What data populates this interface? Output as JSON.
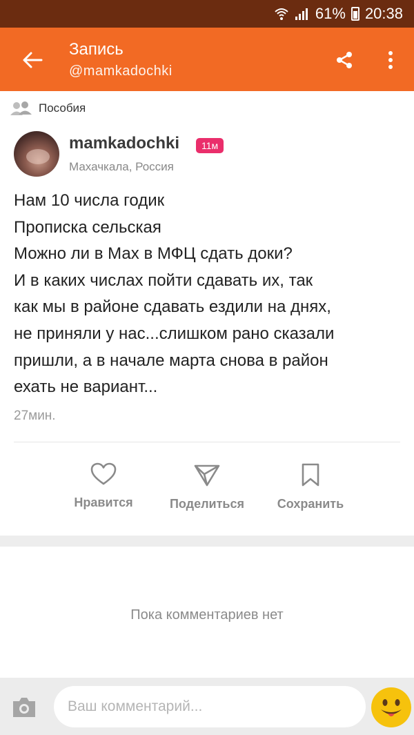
{
  "status_bar": {
    "battery": "61%",
    "time": "20:38"
  },
  "header": {
    "title": "Запись",
    "subtitle": "@mamkadochki",
    "accent_color": "#f26a24"
  },
  "group": {
    "label": "Пособия",
    "icon": "group-icon"
  },
  "author": {
    "name": "mamkadochki",
    "badge": "11м",
    "location": "Махачкала, Россия"
  },
  "post": {
    "lines": [
      "Нам 10 числа годик",
      "Прописка сельская",
      "Можно ли в Мах в МФЦ сдать доки?",
      "И в каких числах пойти сдавать их, так",
      "как мы в районе сдавать ездили на днях,",
      "не приняли у нас...слишком рано сказали",
      "пришли, а в начале марта снова в район",
      "ехать не вариант..."
    ],
    "time": "27мин."
  },
  "actions": {
    "like": "Нравится",
    "share": "Поделиться",
    "save": "Сохранить"
  },
  "comments": {
    "empty_text": "Пока комментариев нет"
  },
  "comment_bar": {
    "placeholder": "Ваш комментарий..."
  }
}
